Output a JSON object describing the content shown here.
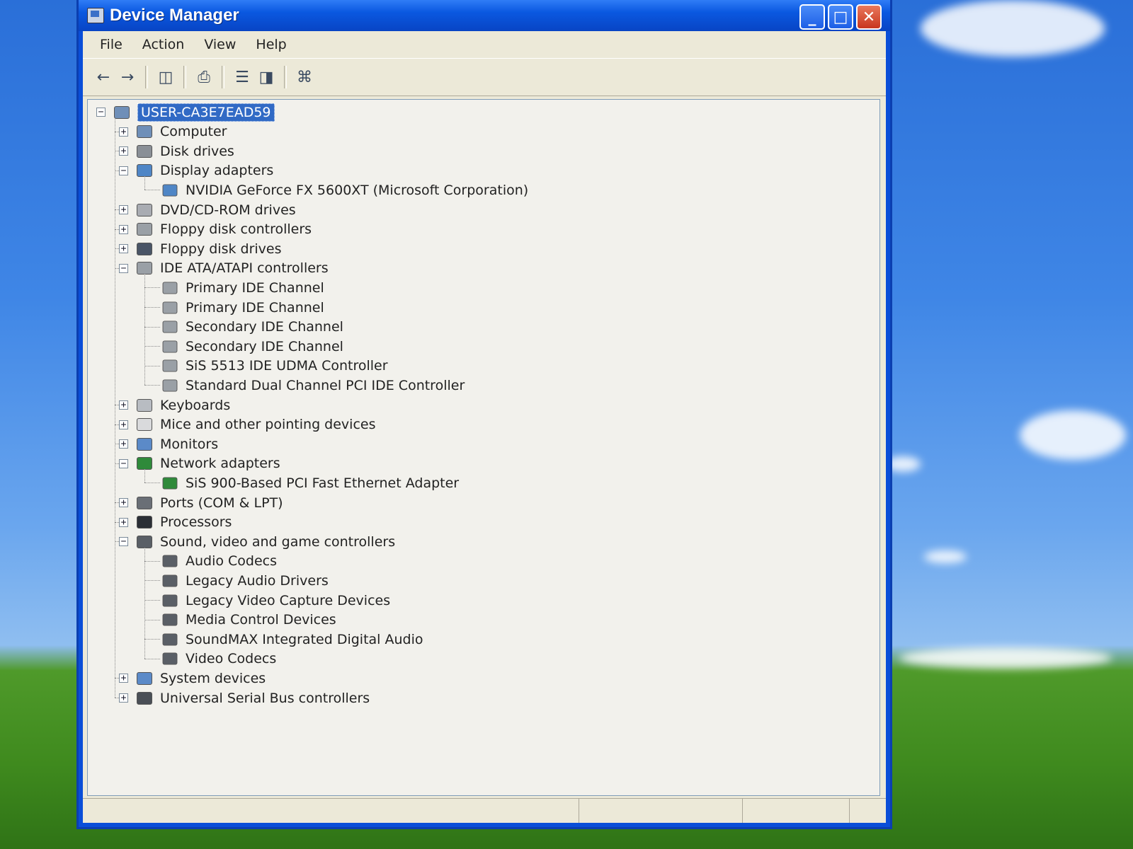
{
  "window": {
    "title": "Device Manager",
    "minimize": "_",
    "maximize": "□",
    "close": "✕"
  },
  "menu": [
    "File",
    "Action",
    "View",
    "Help"
  ],
  "toolbar": [
    "back-icon",
    "forward-icon",
    "show-hide-tree-icon",
    "print-icon",
    "properties-icon",
    "help-icon",
    "scan-hardware-icon"
  ],
  "tree": {
    "root": "USER-CA3E7EAD59",
    "categories": [
      {
        "label": "Computer",
        "expanded": false,
        "icon": "computer-icon",
        "children": []
      },
      {
        "label": "Disk drives",
        "expanded": false,
        "icon": "disk-drive-icon",
        "children": []
      },
      {
        "label": "Display adapters",
        "expanded": true,
        "icon": "display-adapter-icon",
        "children": [
          "NVIDIA GeForce FX 5600XT (Microsoft Corporation)"
        ]
      },
      {
        "label": "DVD/CD-ROM drives",
        "expanded": false,
        "icon": "cdrom-icon",
        "children": []
      },
      {
        "label": "Floppy disk controllers",
        "expanded": false,
        "icon": "controller-icon",
        "children": []
      },
      {
        "label": "Floppy disk drives",
        "expanded": false,
        "icon": "floppy-icon",
        "children": []
      },
      {
        "label": "IDE ATA/ATAPI controllers",
        "expanded": true,
        "icon": "controller-icon",
        "children": [
          "Primary IDE Channel",
          "Primary IDE Channel",
          "Secondary IDE Channel",
          "Secondary IDE Channel",
          "SiS 5513 IDE UDMA Controller",
          "Standard Dual Channel PCI IDE Controller"
        ]
      },
      {
        "label": "Keyboards",
        "expanded": false,
        "icon": "keyboard-icon",
        "children": []
      },
      {
        "label": "Mice and other pointing devices",
        "expanded": false,
        "icon": "mouse-icon",
        "children": []
      },
      {
        "label": "Monitors",
        "expanded": false,
        "icon": "monitor-icon",
        "children": []
      },
      {
        "label": "Network adapters",
        "expanded": true,
        "icon": "network-adapter-icon",
        "children": [
          "SiS 900-Based PCI Fast Ethernet Adapter"
        ]
      },
      {
        "label": "Ports (COM & LPT)",
        "expanded": false,
        "icon": "port-icon",
        "children": []
      },
      {
        "label": "Processors",
        "expanded": false,
        "icon": "processor-icon",
        "children": []
      },
      {
        "label": "Sound, video and game controllers",
        "expanded": true,
        "icon": "sound-icon",
        "children": [
          "Audio Codecs",
          "Legacy Audio Drivers",
          "Legacy Video Capture Devices",
          "Media Control Devices",
          "SoundMAX Integrated Digital Audio",
          "Video Codecs"
        ]
      },
      {
        "label": "System devices",
        "expanded": false,
        "icon": "system-icon",
        "children": []
      },
      {
        "label": "Universal Serial Bus controllers",
        "expanded": false,
        "icon": "usb-icon",
        "children": []
      }
    ]
  },
  "icon_colors": {
    "computer-icon": "#6f8fb8",
    "disk-drive-icon": "#8a8f96",
    "display-adapter-icon": "#4f86c6",
    "cdrom-icon": "#a9acb2",
    "controller-icon": "#9aa0a6",
    "floppy-icon": "#4a5566",
    "keyboard-icon": "#b8bcc2",
    "mouse-icon": "#d9dadc",
    "monitor-icon": "#5b8ac8",
    "network-adapter-icon": "#2f8a3a",
    "port-icon": "#6a6f76",
    "processor-icon": "#2b2f36",
    "sound-icon": "#5a5f66",
    "system-icon": "#5b8ac8",
    "usb-icon": "#4a4f56"
  }
}
